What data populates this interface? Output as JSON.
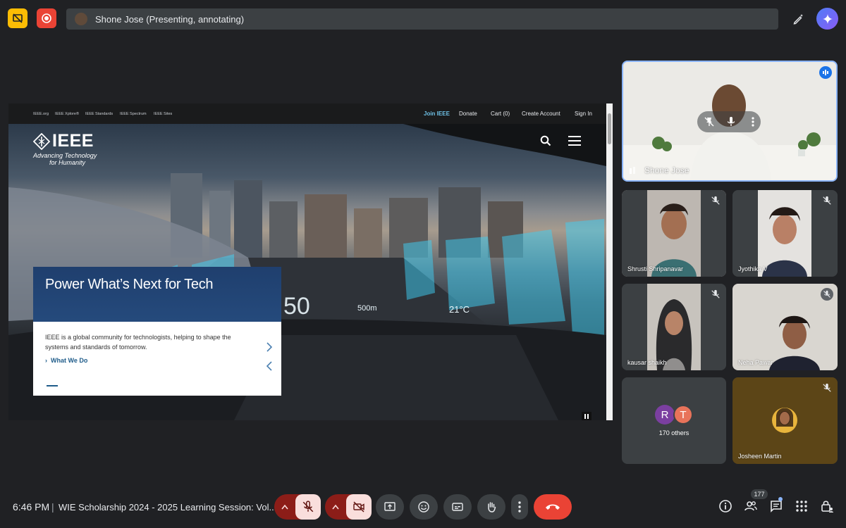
{
  "presenter_bar": {
    "label": "Shone Jose (Presenting, annotating)"
  },
  "presentation": {
    "nav_small": [
      "IEEE.org",
      "IEEE Xplore®",
      "IEEE Standards",
      "IEEE Spectrum",
      "IEEE Sites"
    ],
    "nav_right": [
      "Join IEEE",
      "Donate",
      "Cart (0)",
      "Create Account",
      "Sign In"
    ],
    "logo_text": "IEEE",
    "tagline_1": "Advancing Technology",
    "tagline_2": "for Humanity",
    "hero_title": "Power What’s Next for Tech",
    "hero_desc": "IEEE is a global community for technologists, helping to shape the systems and standards of tomorrow.",
    "hero_link": "What We Do",
    "hud_speed": "50",
    "hud_distance": "500m",
    "hud_temp": "21°C"
  },
  "participants": {
    "main": {
      "name": "Shone Jose"
    },
    "tiles": [
      {
        "name": "Shrusti Shripanavar"
      },
      {
        "name": "Jyothika V"
      },
      {
        "name": "kausar shaikh"
      },
      {
        "name": "Neha Pawar"
      },
      {
        "name": "Josheen Martin"
      }
    ],
    "others": {
      "avatars": [
        "R",
        "T"
      ],
      "label": "170 others"
    }
  },
  "bottom": {
    "time": "6:46 PM",
    "separator": "|",
    "meeting_title": "WIE Scholarship 2024 - 2025 Learning Session: Vol...",
    "people_count": "177"
  },
  "colors": {
    "background": "#202124",
    "end_call": "#ea4335",
    "muted_bg": "#f9dedc",
    "accent_blue": "#8ab4f8"
  }
}
